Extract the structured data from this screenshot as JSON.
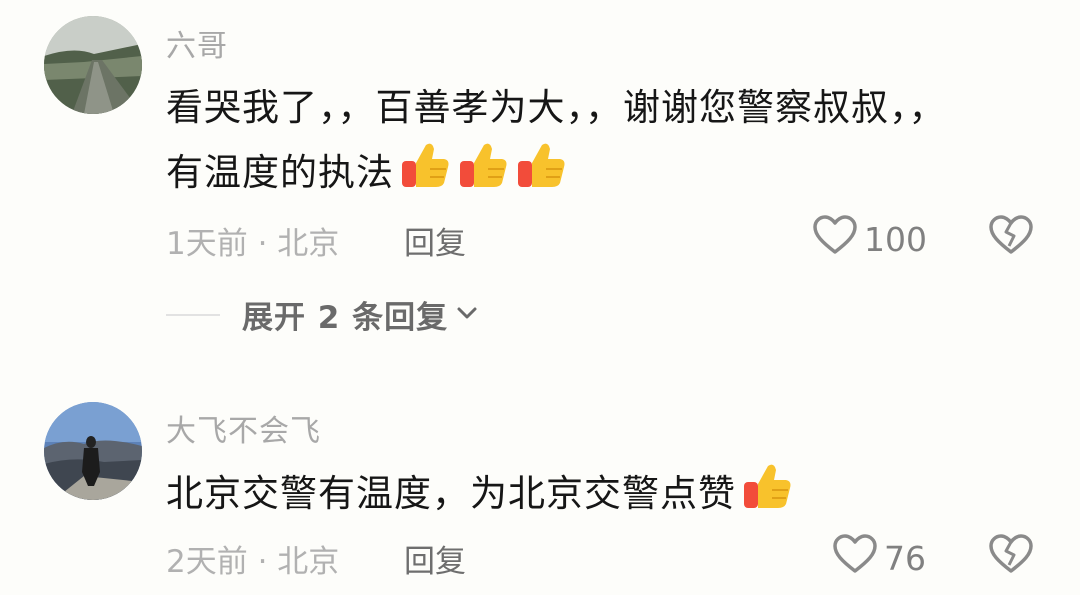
{
  "comments": [
    {
      "username": "六哥",
      "text": "看哭我了，，百善孝为大，，谢谢您警察叔叔，，有温度的执法",
      "emoji_count": 3,
      "time_location": "1天前 · 北京",
      "reply_label": "回复",
      "likes": "100",
      "expand_label": "展开 2 条回复"
    },
    {
      "username": "大飞不会飞",
      "text": "北京交警有温度，为北京交警点赞",
      "emoji_count": 1,
      "time_location": "2天前 · 北京",
      "reply_label": "回复",
      "likes": "76"
    }
  ],
  "icons": {
    "emoji": "thumbs-up-emoji",
    "like": "heart-outline-icon",
    "dislike": "broken-heart-icon",
    "expand": "chevron-down-icon"
  },
  "colors": {
    "text": "#161616",
    "muted": "#a8a8a8",
    "emoji_yellow": "#f8c22c",
    "emoji_red": "#f24c3a"
  }
}
